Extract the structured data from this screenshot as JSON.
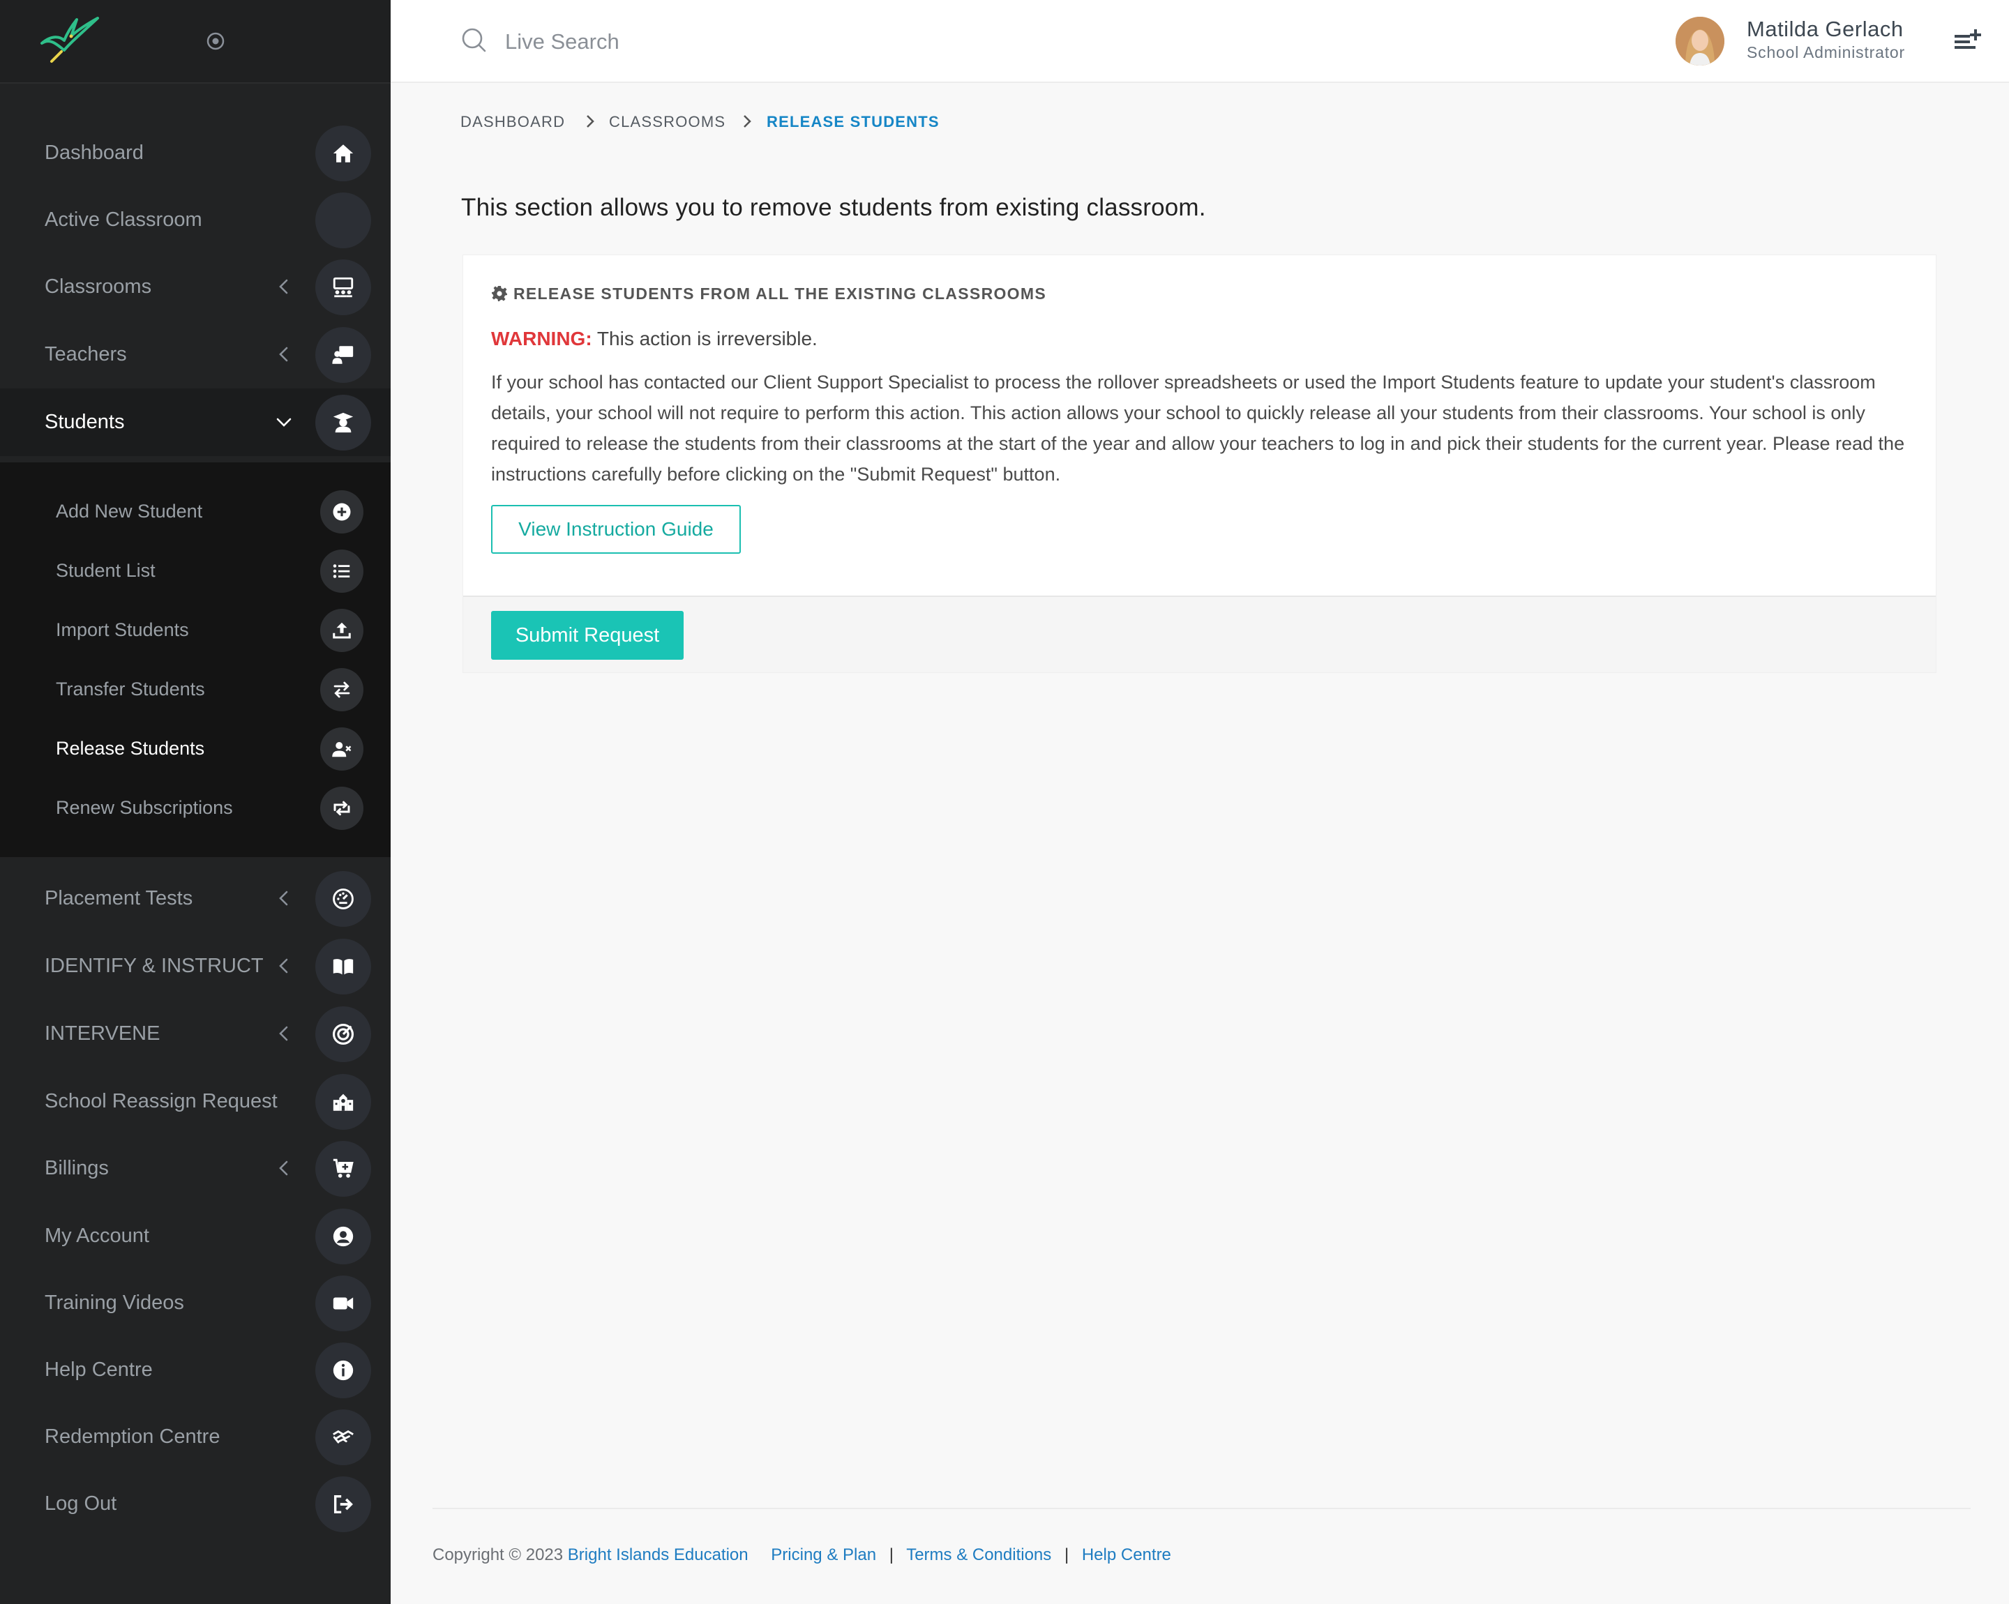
{
  "sidebar": {
    "items": [
      {
        "label": "Dashboard",
        "icon": "home-icon"
      },
      {
        "label": "Active Classroom",
        "icon": "empty-icon"
      },
      {
        "label": "Classrooms",
        "icon": "classroom-icon"
      },
      {
        "label": "Teachers",
        "icon": "teacher-icon"
      },
      {
        "label": "Students",
        "icon": "graduate-icon"
      },
      {
        "label": "Placement Tests",
        "icon": "gauge-icon"
      },
      {
        "label": "IDENTIFY & INSTRUCT",
        "icon": "book-icon"
      },
      {
        "label": "INTERVENE",
        "icon": "target-icon"
      },
      {
        "label": "School Reassign Request",
        "icon": "school-icon"
      },
      {
        "label": "Billings",
        "icon": "cart-icon"
      },
      {
        "label": "My Account",
        "icon": "user-circle-icon"
      },
      {
        "label": "Training Videos",
        "icon": "video-icon"
      },
      {
        "label": "Help Centre",
        "icon": "info-icon"
      },
      {
        "label": "Redemption Centre",
        "icon": "handshake-icon"
      },
      {
        "label": "Log Out",
        "icon": "logout-icon"
      }
    ],
    "students_sub": [
      {
        "label": "Add New Student",
        "icon": "plus-circle-icon"
      },
      {
        "label": "Student List",
        "icon": "list-icon"
      },
      {
        "label": "Import Students",
        "icon": "upload-icon"
      },
      {
        "label": "Transfer Students",
        "icon": "transfer-icon"
      },
      {
        "label": "Release Students",
        "icon": "user-remove-icon"
      },
      {
        "label": "Renew Subscriptions",
        "icon": "renew-icon"
      }
    ]
  },
  "header": {
    "search_placeholder": "Live Search",
    "user_name": "Matilda Gerlach",
    "user_role": "School Administrator"
  },
  "breadcrumb": {
    "items": [
      "DASHBOARD",
      "CLASSROOMS",
      "RELEASE STUDENTS"
    ]
  },
  "main": {
    "intro": "This section allows you to remove students from existing classroom.",
    "card": {
      "title": "RELEASE STUDENTS FROM ALL THE EXISTING CLASSROOMS",
      "warning_label": "WARNING:",
      "warning_text": " This action is irreversible.",
      "description": "If your school has contacted our Client Support Specialist to process the rollover spreadsheets or used the Import Students feature to update your student's classroom details, your school will not require to perform this action. This action allows your school to quickly release all your students from their classrooms. Your school is only required to release the students from their classrooms at the start of the year and allow your teachers to log in and pick their students for the current year. Please read the instructions carefully before clicking on the \"Submit Request\" button.",
      "guide_button": "View Instruction Guide",
      "submit_button": "Submit Request"
    }
  },
  "footer": {
    "copyright": "Copyright © 2023 ",
    "company": "Bright Islands Education",
    "pricing": "Pricing & Plan",
    "terms": "Terms & Conditions",
    "help": "Help Centre",
    "sep": "|"
  },
  "colors": {
    "sidebar_bg": "#222324",
    "accent_teal": "#1ac4b5",
    "link_blue": "#1e7cc1",
    "breadcrumb_active": "#1686c6",
    "warning_red": "#e0373a"
  }
}
